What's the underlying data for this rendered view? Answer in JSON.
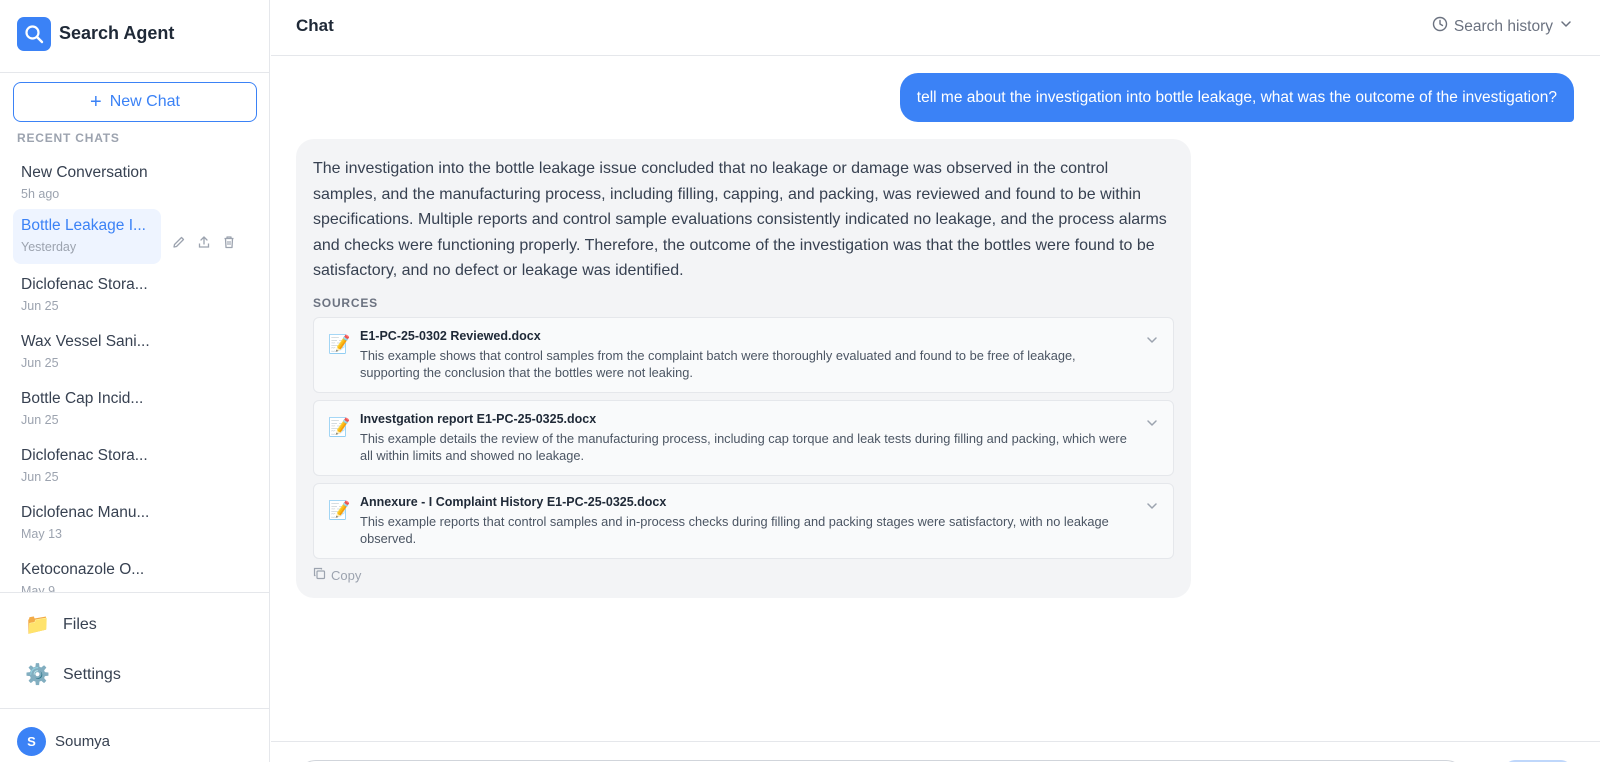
{
  "brand": {
    "title": "Search Agent",
    "icon": "search-icon",
    "accent": "#3b82f6"
  },
  "sidebar": {
    "new_chat_label": "New Chat",
    "recent_label": "RECENT CHATS",
    "chats": [
      {
        "title": "New Conversation",
        "date": "5h ago"
      },
      {
        "title": "Bottle Leakage I...",
        "date": "Yesterday",
        "active": true
      },
      {
        "title": "Diclofenac Stora...",
        "date": "Jun 25"
      },
      {
        "title": "Wax Vessel Sani...",
        "date": "Jun 25"
      },
      {
        "title": "Bottle Cap Incid...",
        "date": "Jun 25"
      },
      {
        "title": "Diclofenac Stora...",
        "date": "Jun 25"
      },
      {
        "title": "Diclofenac Manu...",
        "date": "May 13"
      },
      {
        "title": "Ketoconazole O...",
        "date": "May 9"
      }
    ],
    "files_label": "Files",
    "settings_label": "Settings"
  },
  "user": {
    "initial": "S",
    "name": "Soumya"
  },
  "header": {
    "title": "Chat",
    "history_label": "Search history"
  },
  "conversation": {
    "user_message": "tell me about the investigation into bottle leakage, what was the outcome of the investigation?",
    "assistant_answer": "The investigation into the bottle leakage issue concluded that no leakage or damage was observed in the control samples, and the manufacturing process, including filling, capping, and packing, was reviewed and found to be within specifications. Multiple reports and control sample evaluations consistently indicated no leakage, and the process alarms and checks were functioning properly. Therefore, the outcome of the investigation was that the bottles were found to be satisfactory, and no defect or leakage was identified.",
    "sources_label": "SOURCES",
    "sources": [
      {
        "name": "E1-PC-25-0302 Reviewed.docx",
        "description": "This example shows that control samples from the complaint batch were thoroughly evaluated and found to be free of leakage, supporting the conclusion that the bottles were not leaking."
      },
      {
        "name": "Investgation report E1-PC-25-0325.docx",
        "description": "This example details the review of the manufacturing process, including cap torque and leak tests during filling and packing, which were all within limits and showed no leakage."
      },
      {
        "name": "Annexure - I Complaint History E1-PC-25-0325.docx",
        "description": "This example reports that control samples and in-process checks during filling and packing stages were satisfactory, with no leakage observed."
      }
    ],
    "copy_label": "Copy"
  }
}
